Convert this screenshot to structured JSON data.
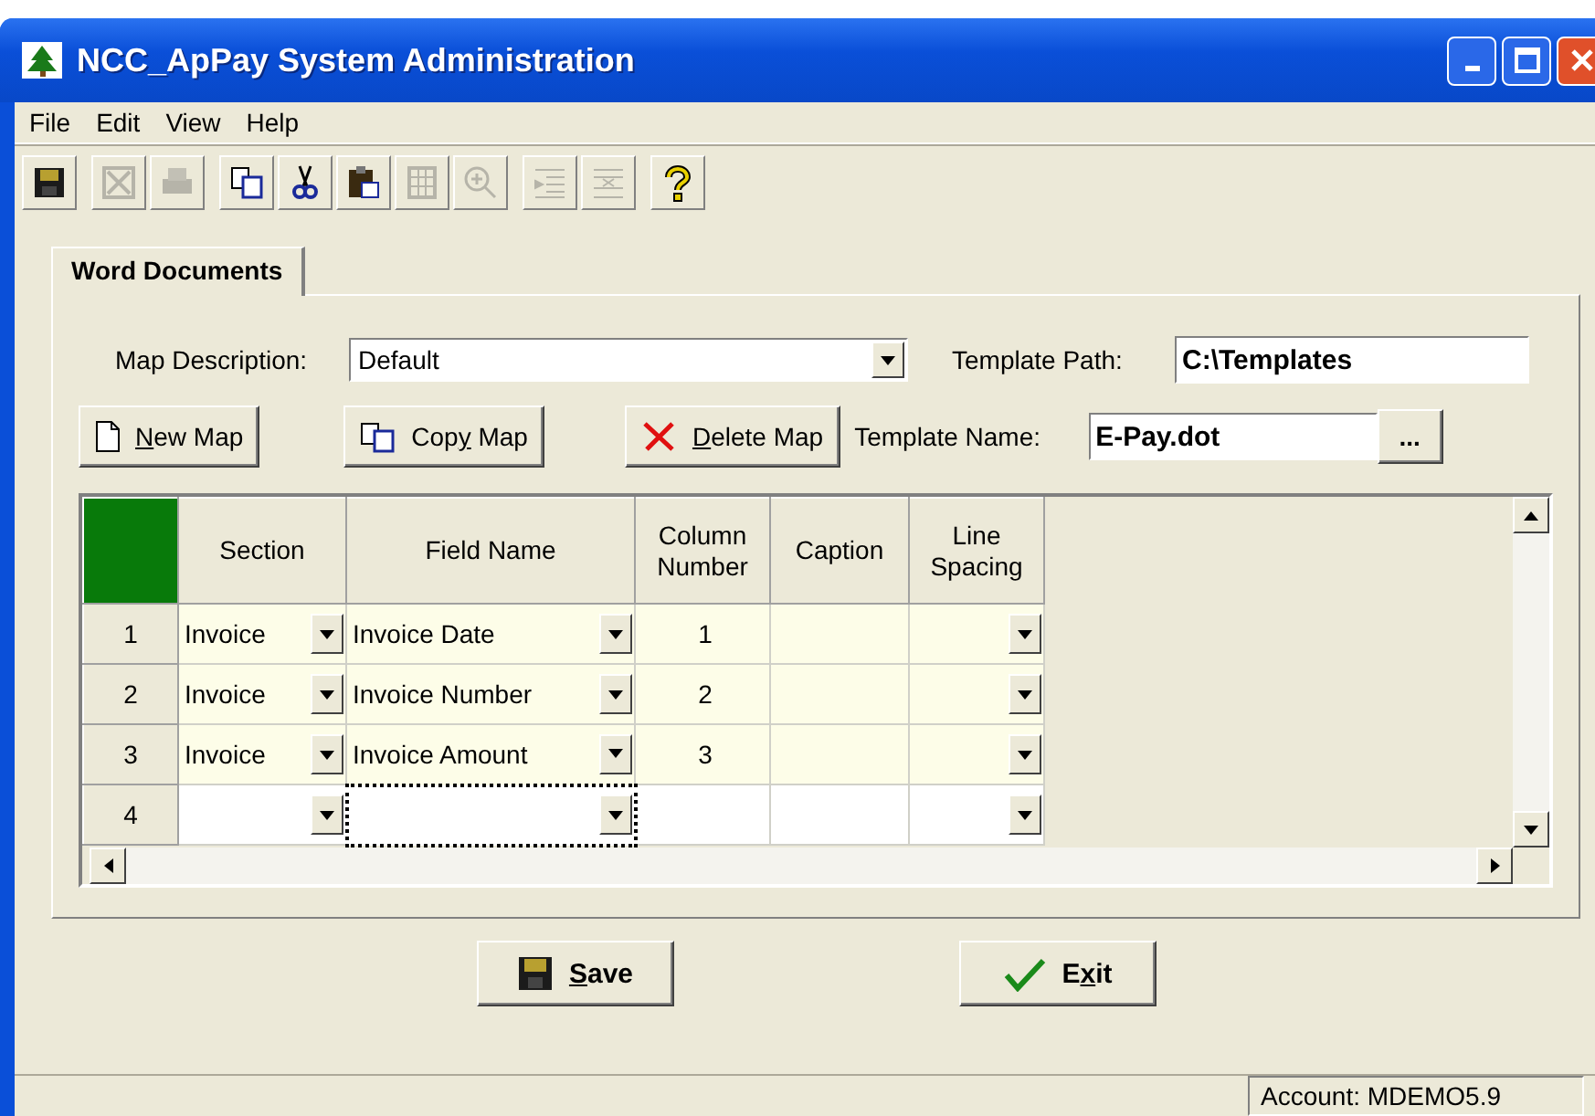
{
  "window": {
    "title": "NCC_ApPay System Administration"
  },
  "menu": [
    "File",
    "Edit",
    "View",
    "Help"
  ],
  "toolbar": [
    {
      "kind": "save",
      "disabled": false
    },
    {
      "kind": "excel",
      "disabled": true
    },
    {
      "kind": "print",
      "disabled": true
    },
    {
      "kind": "copy",
      "disabled": false
    },
    {
      "kind": "cut",
      "disabled": false
    },
    {
      "kind": "paste",
      "disabled": false
    },
    {
      "kind": "grid",
      "disabled": true
    },
    {
      "kind": "zoom",
      "disabled": true
    },
    {
      "kind": "indent",
      "disabled": true
    },
    {
      "kind": "outdent",
      "disabled": true
    },
    {
      "kind": "help",
      "disabled": false
    }
  ],
  "tabs": [
    {
      "label": "Word Documents",
      "selected": true
    }
  ],
  "map_description": {
    "label": "Map Description:",
    "value": "Default"
  },
  "template_path": {
    "label": "Template Path:",
    "value": "C:\\Templates"
  },
  "template_name": {
    "label": "Template Name:",
    "value": "E-Pay.dot",
    "browse": "..."
  },
  "map_buttons": [
    {
      "kind": "new",
      "key": "N",
      "post": "ew Map"
    },
    {
      "kind": "copy",
      "pre": "Cop",
      "key": "y",
      "post": " Map"
    },
    {
      "kind": "delete",
      "key": "D",
      "post": "elete Map"
    }
  ],
  "grid": {
    "columns": [
      {
        "label": "Section",
        "kind": "dropdown"
      },
      {
        "label": "Field Name",
        "kind": "dropdown"
      },
      {
        "label": "Column Number",
        "kind": "number"
      },
      {
        "label": "Caption",
        "kind": "text"
      },
      {
        "label": "Line Spacing",
        "kind": "dropdown"
      }
    ],
    "rows": [
      {
        "number": "1",
        "highlighted": true,
        "cells": [
          {
            "text": "Invoice",
            "focused": false
          },
          {
            "text": "Invoice Date",
            "focused": false
          },
          {
            "text": "1",
            "focused": false
          },
          {
            "focused": false
          },
          {
            "focused": false
          }
        ]
      },
      {
        "number": "2",
        "highlighted": true,
        "cells": [
          {
            "text": "Invoice",
            "focused": false
          },
          {
            "text": "Invoice Number",
            "focused": false
          },
          {
            "text": "2",
            "focused": false
          },
          {
            "focused": false
          },
          {
            "focused": false
          }
        ]
      },
      {
        "number": "3",
        "highlighted": true,
        "cells": [
          {
            "text": "Invoice",
            "focused": false
          },
          {
            "text": "Invoice Amount",
            "focused": false
          },
          {
            "text": "3",
            "focused": false
          },
          {
            "focused": false
          },
          {
            "focused": false
          }
        ]
      },
      {
        "number": "4",
        "highlighted": false,
        "cells": [
          {
            "focused": false
          },
          {
            "focused": true
          },
          {
            "focused": false
          },
          {
            "focused": false
          },
          {
            "focused": false
          }
        ]
      }
    ]
  },
  "actions": [
    {
      "kind": "save",
      "key": "S",
      "post": "ave"
    },
    {
      "kind": "exit",
      "pre": "E",
      "key": "x",
      "post": "it"
    }
  ],
  "status_bar": {
    "account": "Account: MDEMO5.9"
  }
}
